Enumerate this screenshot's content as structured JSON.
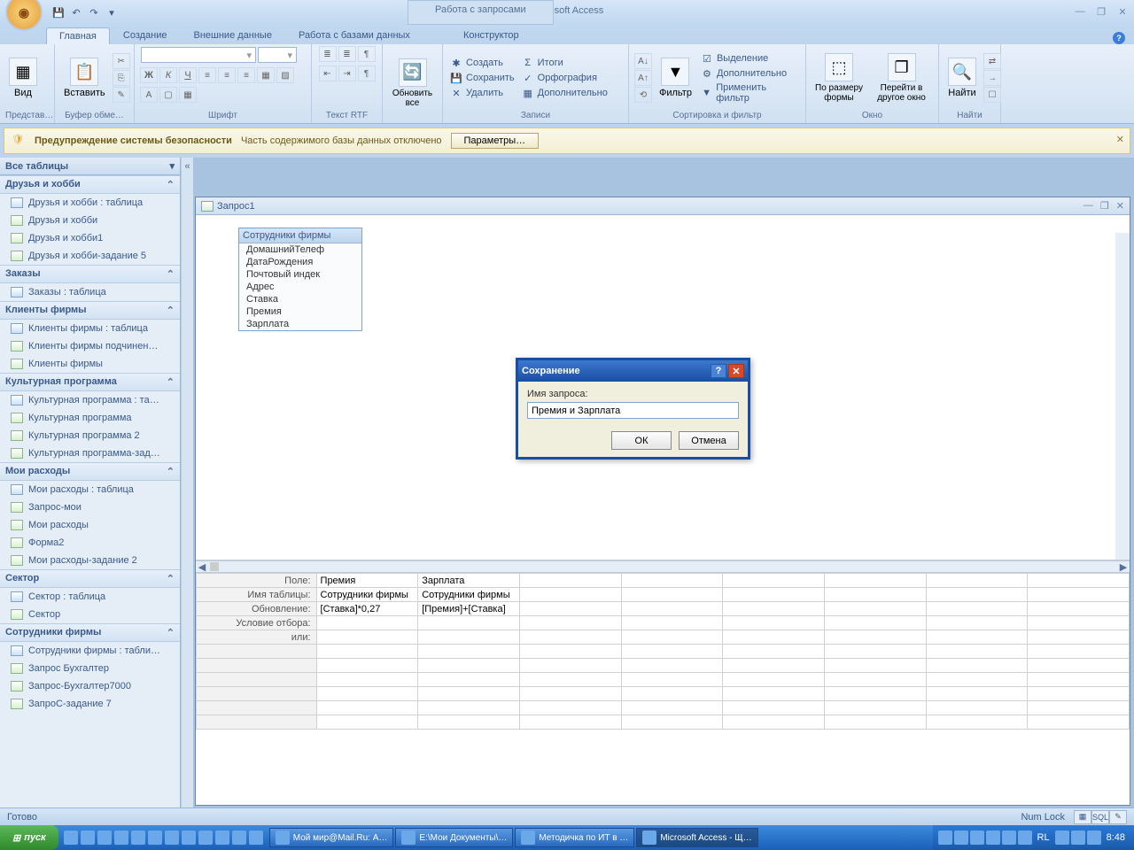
{
  "title": {
    "app": "Microsoft Access",
    "context": "Работа с запросами"
  },
  "window_controls": {
    "min": "—",
    "max": "❐",
    "close": "✕"
  },
  "qat": {
    "save": "💾",
    "undo": "↶",
    "redo": "↷",
    "more": "▾"
  },
  "ribbon_tabs": {
    "home": "Главная",
    "create": "Создание",
    "external": "Внешние данные",
    "dbtools": "Работа с базами данных",
    "design": "Конструктор"
  },
  "ribbon": {
    "grp_view_label": "Представ…",
    "view": "Вид",
    "grp_clip_label": "Буфер обме…",
    "paste": "Вставить",
    "grp_font_label": "Шрифт",
    "grp_rtf_label": "Текст RTF",
    "grp_records_label": "Записи",
    "refresh": "Обновить все",
    "rec_create": "Создать",
    "rec_save": "Сохранить",
    "rec_delete": "Удалить",
    "rec_totals": "Итоги",
    "rec_spell": "Орфография",
    "rec_more": "Дополнительно",
    "grp_sort_label": "Сортировка и фильтр",
    "filter": "Фильтр",
    "sort_sel": "Выделение",
    "sort_adv": "Дополнительно",
    "sort_apply": "Применить фильтр",
    "grp_window_label": "Окно",
    "win_fit": "По размеру формы",
    "win_switch": "Перейти в другое окно",
    "grp_find_label": "Найти",
    "find": "Найти"
  },
  "security": {
    "bold": "Предупреждение системы безопасности",
    "text": "Часть содержимого базы данных отключено",
    "btn": "Параметры…"
  },
  "nav": {
    "head": "Все таблицы",
    "groups": [
      {
        "title": "Друзья и хобби",
        "items": [
          {
            "t": "t",
            "label": "Друзья и хобби : таблица"
          },
          {
            "t": "q",
            "label": "Друзья и хобби"
          },
          {
            "t": "q",
            "label": "Друзья и хобби1"
          },
          {
            "t": "q",
            "label": "Друзья и хобби-задание 5"
          }
        ]
      },
      {
        "title": "Заказы",
        "items": [
          {
            "t": "t",
            "label": "Заказы : таблица"
          }
        ]
      },
      {
        "title": "Клиенты фирмы",
        "items": [
          {
            "t": "t",
            "label": "Клиенты фирмы : таблица"
          },
          {
            "t": "q",
            "label": "Клиенты фирмы подчинен…"
          },
          {
            "t": "q",
            "label": "Клиенты фирмы"
          }
        ]
      },
      {
        "title": "Культурная программа",
        "items": [
          {
            "t": "t",
            "label": "Культурная программа : та…"
          },
          {
            "t": "q",
            "label": "Культурная программа"
          },
          {
            "t": "q",
            "label": "Культурная программа 2"
          },
          {
            "t": "q",
            "label": "Культурная программа-зад…"
          }
        ]
      },
      {
        "title": "Мои расходы",
        "items": [
          {
            "t": "t",
            "label": "Мои расходы : таблица"
          },
          {
            "t": "q",
            "label": "Запрос-мои"
          },
          {
            "t": "q",
            "label": "Мои расходы"
          },
          {
            "t": "q",
            "label": "Форма2"
          },
          {
            "t": "q",
            "label": "Мои расходы-задание 2"
          }
        ]
      },
      {
        "title": "Сектор",
        "items": [
          {
            "t": "t",
            "label": "Сектор : таблица"
          },
          {
            "t": "q",
            "label": "Сектор"
          }
        ]
      },
      {
        "title": "Сотрудники фирмы",
        "items": [
          {
            "t": "t",
            "label": "Сотрудники фирмы : табли…"
          },
          {
            "t": "q",
            "label": "Запрос Бухгалтер"
          },
          {
            "t": "q",
            "label": "Запрос-Бухгалтер7000"
          },
          {
            "t": "q",
            "label": "ЗапроС-задание 7"
          }
        ]
      }
    ]
  },
  "doc": {
    "title": "Запрос1",
    "table_name": "Сотрудники фирмы",
    "fields": [
      "ДомашнийТелеф",
      "ДатаРождения",
      "Почтовый индек",
      "Адрес",
      "Ставка",
      "Премия",
      "Зарплата"
    ]
  },
  "grid": {
    "rows": [
      "Поле:",
      "Имя таблицы:",
      "Обновление:",
      "Условие отбора:",
      "или:"
    ],
    "cols": [
      {
        "field": "Премия",
        "table": "Сотрудники фирмы",
        "update": "[Ставка]*0,27"
      },
      {
        "field": "Зарплата",
        "table": "Сотрудники фирмы",
        "update": "[Премия]+[Ставка]"
      }
    ]
  },
  "dialog": {
    "title": "Сохранение",
    "label": "Имя запроса:",
    "value": "Премия и Зарплата",
    "ok": "ОК",
    "cancel": "Отмена"
  },
  "status": {
    "ready": "Готово",
    "numlock": "Num Lock",
    "sql": "SQL"
  },
  "taskbar": {
    "start": "пуск",
    "tasks": [
      {
        "label": "Мой мир@Mail.Ru: А…"
      },
      {
        "label": "E:\\Мои Документы\\…"
      },
      {
        "label": "Методичка по ИТ в …"
      },
      {
        "label": "Microsoft Access - Щ…",
        "active": true
      }
    ],
    "lang": "RL",
    "time": "8:48"
  }
}
